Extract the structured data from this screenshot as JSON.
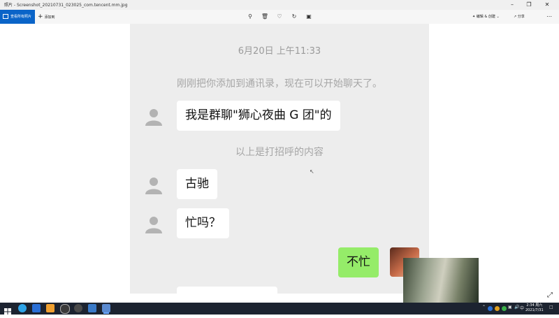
{
  "window": {
    "title": "照片 - Screenshot_20210731_023025_com.tencent.mm.jpg",
    "minimize_icon": "minimize-icon",
    "maximize_icon": "maximize-icon",
    "close_icon": "close-icon"
  },
  "toolbar": {
    "view_all": "查看所有照片",
    "add": "添加到",
    "edit_create": "编辑 & 创建",
    "share": "分享",
    "icons": [
      "zoom-icon",
      "delete-icon",
      "favorite-icon",
      "rotate-icon",
      "crop-icon",
      "more-icon"
    ]
  },
  "chat": {
    "timestamp": "6月20日 上午11:33",
    "system_message_1": "刚刚把你添加到通讯录，现在可以开始聊天了。",
    "message_1": "我是群聊\"狮心夜曲 G 团\"的",
    "system_message_2": "以上是打招呼的内容",
    "message_2": "古驰",
    "message_3": "忙吗？",
    "message_me": "不忙",
    "background_color": "#ededed",
    "my_bubble_color": "#95ec69"
  },
  "taskbar": {
    "clock_time": "2:34 周六",
    "clock_date": "2021/7/31",
    "tray_text": "中",
    "accent": "#0a64c8"
  }
}
